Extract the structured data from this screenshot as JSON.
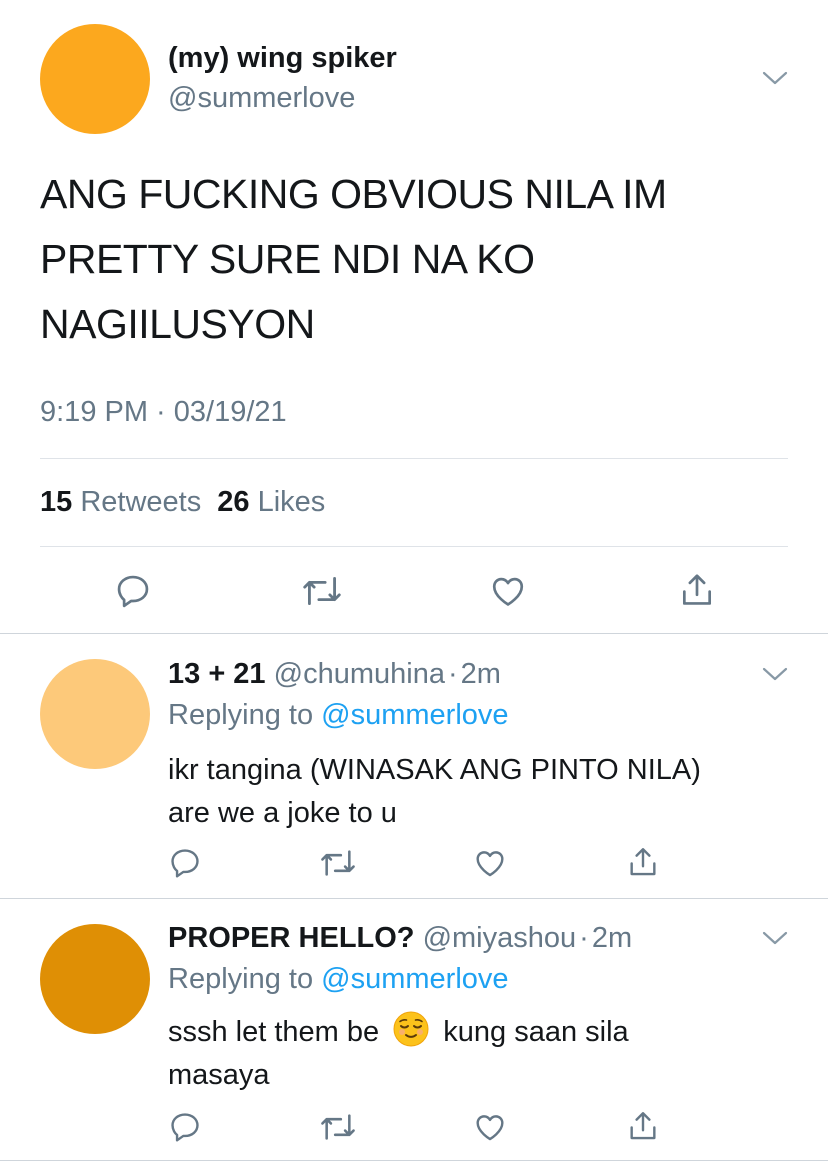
{
  "tweet": {
    "avatar_color": "#fca81e",
    "display_name": "(my) wing spiker",
    "handle": "@summerlove",
    "text_lines": [
      "ANG FUCKING OBVIOUS NILA IM",
      "PRETTY SURE NDI NA KO",
      "NAGIILUSYON"
    ],
    "timestamp": "9:19 PM · 03/19/21",
    "retweets_count": "15",
    "retweets_label": "Retweets",
    "likes_count": "26",
    "likes_label": "Likes"
  },
  "replies": [
    {
      "avatar_color": "#fdc97a",
      "display_name": "13 + 21",
      "handle": "@chumuhina",
      "sep": "·",
      "time": "2m",
      "replying_prefix": "Replying to",
      "replying_handle": "@summerlove",
      "text_line1": "ikr tangina (WINASAK ANG PINTO NILA)",
      "text_line2": "are we a joke to u"
    },
    {
      "avatar_color": "#df8f05",
      "display_name": "PROPER HELLO?",
      "handle": "@miyashou",
      "sep": "·",
      "time": "2m",
      "replying_prefix": "Replying to",
      "replying_handle": "@summerlove",
      "text_line1_a": "sssh let them be",
      "emoji": "relieved-face",
      "text_line1_b": "kung saan sila",
      "text_line2": "masaya"
    }
  ],
  "colors": {
    "icon_gray": "#657786",
    "link_blue": "#1da1f2"
  }
}
